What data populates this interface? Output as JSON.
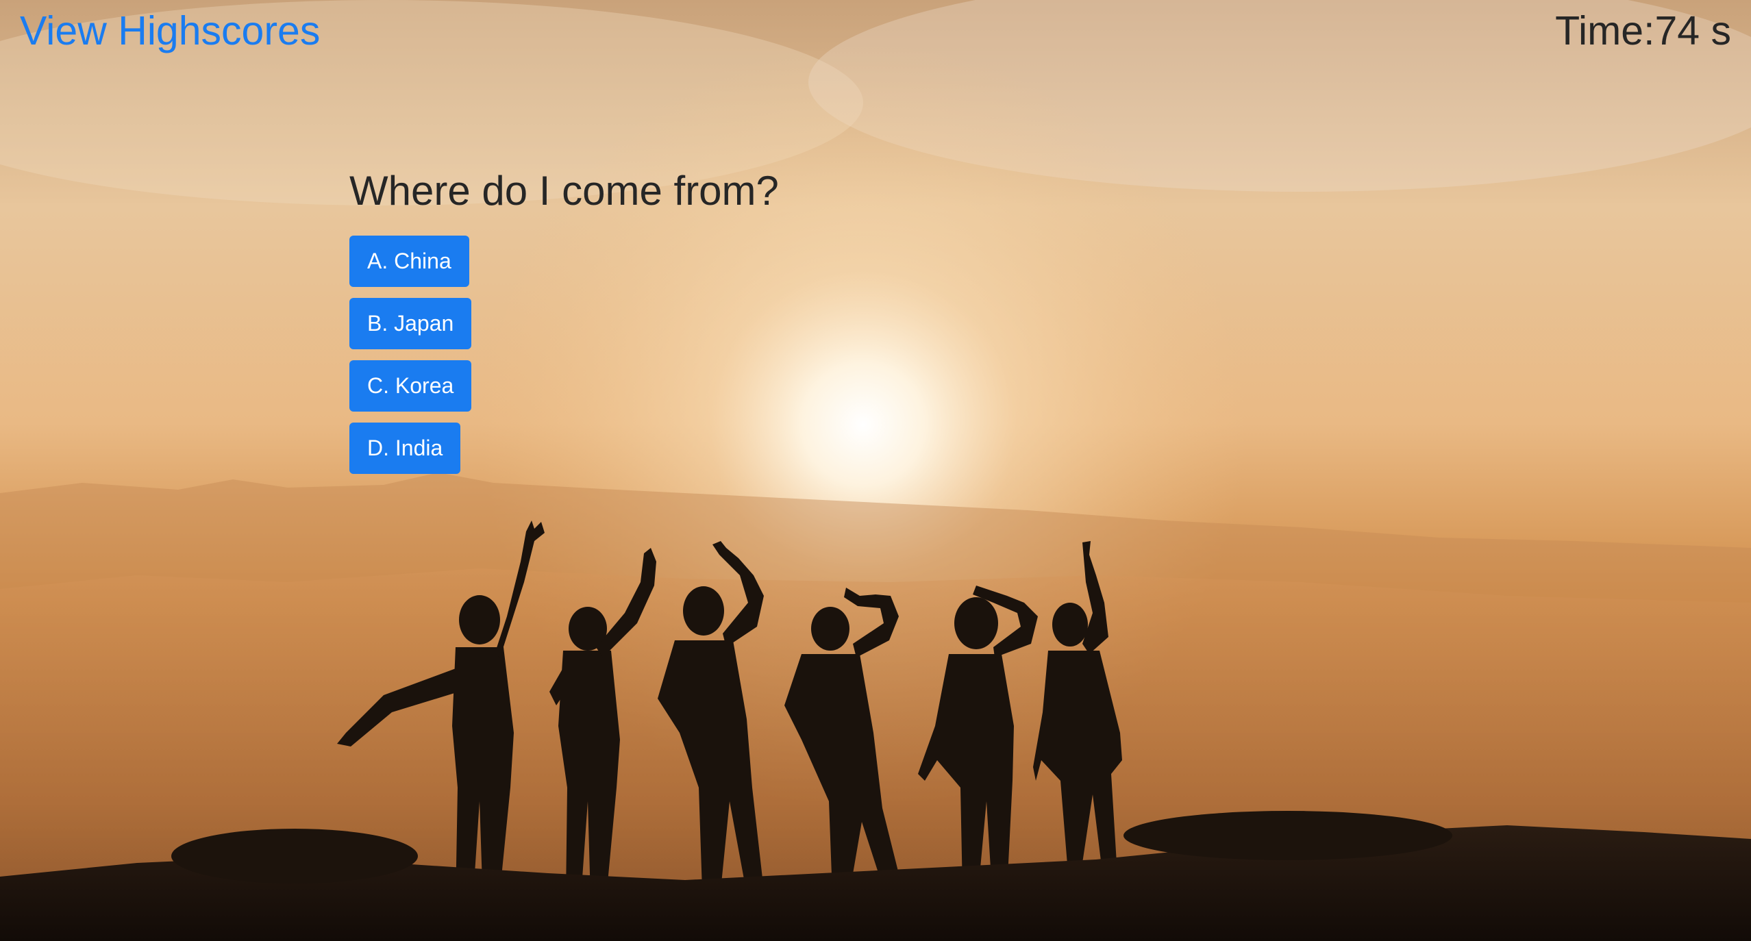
{
  "header": {
    "highscores_link": "View Highscores",
    "timer": "Time:74 s"
  },
  "quiz": {
    "question": "Where do I come from?",
    "choices": [
      {
        "label": "A. China"
      },
      {
        "label": "B. Japan"
      },
      {
        "label": "C. Korea"
      },
      {
        "label": "D. India"
      }
    ]
  },
  "colors": {
    "accent": "#1a7cf0",
    "text": "#262626",
    "button_text": "#ffffff"
  }
}
